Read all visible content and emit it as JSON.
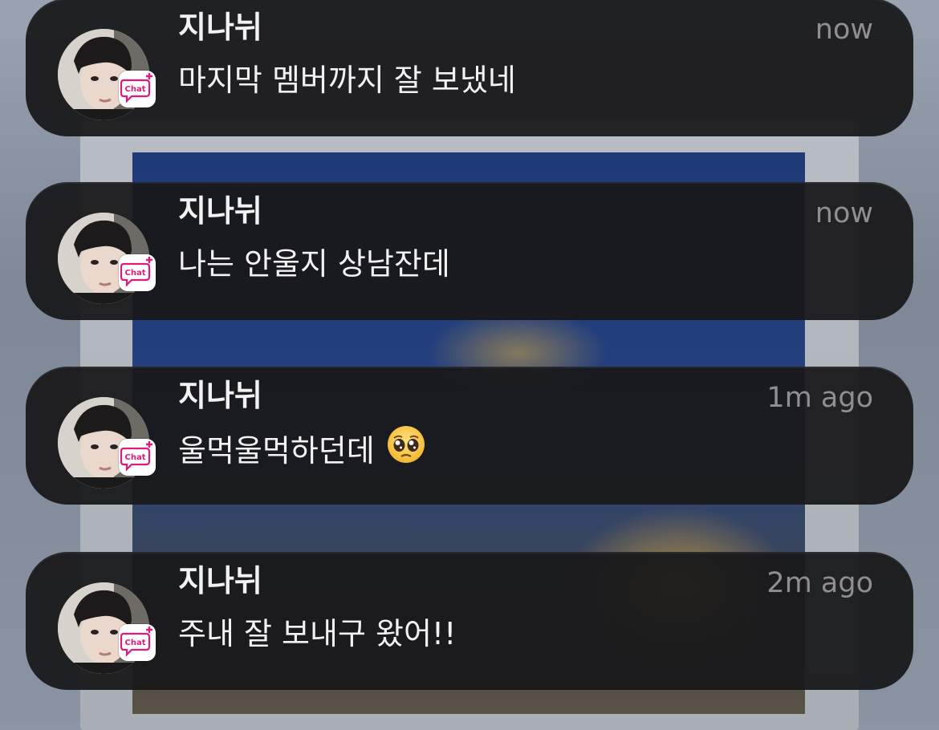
{
  "notifications": [
    {
      "sender": "지나뉘",
      "message": "마지막 멤버까지 잘 보냈네",
      "time": "now",
      "emoji": ""
    },
    {
      "sender": "지나뉘",
      "message": "나는 안울지 상남잔데",
      "time": "now",
      "emoji": ""
    },
    {
      "sender": "지나뉘",
      "message": "울먹울먹하던데",
      "time": "1m ago",
      "emoji": "pleading-face-emoji"
    },
    {
      "sender": "지나뉘",
      "message": "주내 잘 보내구 왔어!!",
      "time": "2m ago",
      "emoji": ""
    }
  ],
  "app_badge": {
    "label": "Chat",
    "accent": "#e0197a",
    "icon": "chat-plus-icon"
  },
  "colors": {
    "card_background": "#18181b",
    "primary_text": "#f2f2f4",
    "secondary_text": "#8e8e93"
  }
}
